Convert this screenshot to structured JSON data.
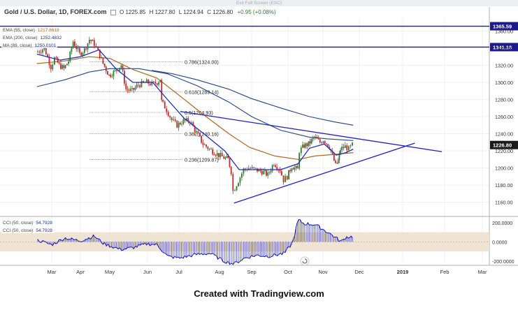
{
  "banner": {
    "text": "Exit Full Screen (ESC)"
  },
  "header": {
    "symbol": "Gold / U.S. Dollar, 1D, FOREX.com",
    "open": "O 1225.85",
    "high": "H 1227.80",
    "low": "L 1224.94",
    "close": "C 1226.80",
    "change": "+0.95 (+0.08%)"
  },
  "indicators": {
    "ema1": {
      "label": "EMA (55, close)",
      "value": "1217.8618"
    },
    "ema2": {
      "label": "EMA (200, close)",
      "value": "1252.4832"
    },
    "ma": {
      "label": "MA (89, close)",
      "value": "1250.0101"
    },
    "cci1": {
      "label": "CCI (50, close)",
      "value": "54.7928"
    },
    "cci2": {
      "label": "CCI (50, close)",
      "value": "54.7928"
    }
  },
  "footer": {
    "text": "Created with Tradingview.com"
  },
  "colors": {
    "price_up": "#2e7d32",
    "price_down": "#c62828",
    "ema_short": "#1a2fc4",
    "ema_mid": "#b5651d",
    "ema_long": "#22448e",
    "trendline": "#1f1fc8",
    "hline": "#1a1ab8",
    "cci": "#1414c8",
    "cci_band": "#efe4d3"
  },
  "chart_data": [
    {
      "type": "candlestick",
      "x_tick_labels": [
        "Mar",
        "Apr",
        "May",
        "Jun",
        "Jul",
        "Aug",
        "Sep",
        "Oct",
        "Nov",
        "Dec",
        "2019",
        "Feb",
        "Mar"
      ],
      "y_tick_labels": [
        "1160.00",
        "1180.00",
        "1200.00",
        "1220.00",
        "1240.00",
        "1260.00",
        "1280.00",
        "1300.00",
        "1320.00",
        "1340.00",
        "1360.00"
      ],
      "ylim": [
        1145,
        1375
      ],
      "last_price": 1226.8,
      "horizontal_levels": [
        {
          "value": 1365.59,
          "label": "1365.59"
        },
        {
          "value": 1341.18,
          "label": "1341.18"
        }
      ],
      "fibonacci_levels": [
        {
          "label": "0.786(1324.00)",
          "value": 1324.0
        },
        {
          "label": "0.618(1289.14)",
          "value": 1289.14
        },
        {
          "label": "0.5(1264.93)",
          "value": 1264.93
        },
        {
          "label": "0.382(1240.16)",
          "value": 1240.16
        },
        {
          "label": "0.236(1209.87)",
          "value": 1209.87
        }
      ],
      "close_path": [
        [
          "Feb 20",
          1335
        ],
        [
          "Feb 25",
          1340
        ],
        [
          "Mar 1",
          1318
        ],
        [
          "Mar 5",
          1328
        ],
        [
          "Mar 10",
          1320
        ],
        [
          "Mar 15",
          1316
        ],
        [
          "Mar 20",
          1325
        ],
        [
          "Mar 25",
          1348
        ],
        [
          "Apr 1",
          1333
        ],
        [
          "Apr 6",
          1338
        ],
        [
          "Apr 11",
          1350
        ],
        [
          "Apr 16",
          1345
        ],
        [
          "Apr 20",
          1336
        ],
        [
          "Apr 25",
          1322
        ],
        [
          "May 1",
          1308
        ],
        [
          "May 6",
          1313
        ],
        [
          "May 11",
          1320
        ],
        [
          "May 15",
          1292
        ],
        [
          "May 20",
          1290
        ],
        [
          "May 25",
          1297
        ],
        [
          "Jun 1",
          1300
        ],
        [
          "Jun 6",
          1298
        ],
        [
          "Jun 11",
          1300
        ],
        [
          "Jun 14",
          1304
        ],
        [
          "Jun 15",
          1278
        ],
        [
          "Jun 20",
          1268
        ],
        [
          "Jun 25",
          1256
        ],
        [
          "Jun 30",
          1250
        ],
        [
          "Jul 5",
          1255
        ],
        [
          "Jul 10",
          1255
        ],
        [
          "Jul 15",
          1241
        ],
        [
          "Jul 20",
          1228
        ],
        [
          "Jul 25",
          1222
        ],
        [
          "Aug 1",
          1215
        ],
        [
          "Aug 6",
          1212
        ],
        [
          "Aug 10",
          1210
        ],
        [
          "Aug 13",
          1196
        ],
        [
          "Aug 15",
          1173
        ],
        [
          "Aug 20",
          1185
        ],
        [
          "Aug 25",
          1198
        ],
        [
          "Aug 30",
          1200
        ],
        [
          "Sep 5",
          1198
        ],
        [
          "Sep 10",
          1196
        ],
        [
          "Sep 15",
          1192
        ],
        [
          "Sep 20",
          1206
        ],
        [
          "Sep 25",
          1198
        ],
        [
          "Sep 28",
          1186
        ],
        [
          "Oct 1",
          1190
        ],
        [
          "Oct 5",
          1202
        ],
        [
          "Oct 10",
          1198
        ],
        [
          "Oct 12",
          1220
        ],
        [
          "Oct 16",
          1226
        ],
        [
          "Oct 20",
          1228
        ],
        [
          "Oct 25",
          1236
        ],
        [
          "Oct 30",
          1230
        ],
        [
          "Nov 2",
          1233
        ],
        [
          "Nov 7",
          1225
        ],
        [
          "Nov 12",
          1203
        ],
        [
          "Nov 14",
          1208
        ],
        [
          "Nov 16",
          1222
        ],
        [
          "Nov 20",
          1225
        ],
        [
          "Nov 23",
          1222
        ],
        [
          "Nov 26",
          1226.8
        ]
      ],
      "ema_short_path": [
        [
          "Feb 20",
          1333
        ],
        [
          "Mar 10",
          1326
        ],
        [
          "Apr 1",
          1330
        ],
        [
          "Apr 20",
          1338
        ],
        [
          "May 6",
          1316
        ],
        [
          "May 20",
          1300
        ],
        [
          "Jun 6",
          1300
        ],
        [
          "Jun 20",
          1280
        ],
        [
          "Jul 5",
          1258
        ],
        [
          "Jul 20",
          1240
        ],
        [
          "Aug 6",
          1220
        ],
        [
          "Aug 20",
          1198
        ],
        [
          "Sep 10",
          1198
        ],
        [
          "Sep 25",
          1198
        ],
        [
          "Oct 10",
          1205
        ],
        [
          "Oct 20",
          1223
        ],
        [
          "Nov 2",
          1228
        ],
        [
          "Nov 12",
          1215
        ],
        [
          "Nov 20",
          1218
        ],
        [
          "Nov 26",
          1222
        ]
      ],
      "ema_mid_path": [
        [
          "Feb 20",
          1322
        ],
        [
          "Mar 15",
          1325
        ],
        [
          "Apr 10",
          1330
        ],
        [
          "May 1",
          1328
        ],
        [
          "May 20",
          1315
        ],
        [
          "Jun 10",
          1305
        ],
        [
          "Jul 1",
          1285
        ],
        [
          "Jul 20",
          1262
        ],
        [
          "Aug 10",
          1240
        ],
        [
          "Aug 30",
          1224
        ],
        [
          "Sep 20",
          1214
        ],
        [
          "Oct 10",
          1210
        ],
        [
          "Oct 25",
          1214
        ],
        [
          "Nov 12",
          1216
        ],
        [
          "Nov 26",
          1217.9
        ]
      ],
      "ema_long_path": [
        [
          "Feb 20",
          1295
        ],
        [
          "Mar 15",
          1303
        ],
        [
          "Apr 10",
          1312
        ],
        [
          "May 1",
          1316
        ],
        [
          "May 25",
          1316
        ],
        [
          "Jun 20",
          1310
        ],
        [
          "Jul 15",
          1296
        ],
        [
          "Aug 10",
          1277
        ],
        [
          "Sep 1",
          1260
        ],
        [
          "Sep 25",
          1244
        ],
        [
          "Oct 20",
          1236
        ],
        [
          "Nov 5",
          1234
        ],
        [
          "Nov 26",
          1232
        ]
      ],
      "ma_long_path": [
        [
          "Jun 5",
          1314
        ],
        [
          "Jun 25",
          1310
        ],
        [
          "Jul 15",
          1303
        ],
        [
          "Aug 10",
          1292
        ],
        [
          "Sep 1",
          1281
        ],
        [
          "Sep 25",
          1270
        ],
        [
          "Oct 20",
          1260
        ],
        [
          "Nov 10",
          1254
        ],
        [
          "Nov 26",
          1250
        ]
      ],
      "trendlines": [
        {
          "from": [
            "Jul 2",
            1266
          ],
          "to": [
            "Jan 30",
            1219
          ]
        },
        {
          "from": [
            "Aug 15",
            1159
          ],
          "to": [
            "Jan 10",
            1229
          ]
        }
      ]
    },
    {
      "type": "line",
      "name": "CCI",
      "y_tick_labels": [
        "200.0000",
        "0.0000",
        "-200.0000"
      ],
      "ylim": [
        -230,
        250
      ],
      "band": [
        -100,
        100
      ],
      "last_value": 54.7928,
      "path": [
        [
          "Feb 20",
          20
        ],
        [
          "Mar 1",
          -30
        ],
        [
          "Mar 15",
          40
        ],
        [
          "Apr 1",
          10
        ],
        [
          "Apr 15",
          60
        ],
        [
          "Apr 25",
          -20
        ],
        [
          "May 10",
          -80
        ],
        [
          "May 20",
          -60
        ],
        [
          "Jun 1",
          -20
        ],
        [
          "Jun 10",
          -30
        ],
        [
          "Jun 20",
          -150
        ],
        [
          "Jul 1",
          -170
        ],
        [
          "Jul 15",
          -130
        ],
        [
          "Jul 25",
          -120
        ],
        [
          "Aug 5",
          -200
        ],
        [
          "Aug 15",
          -230
        ],
        [
          "Aug 25",
          -170
        ],
        [
          "Sep 5",
          -140
        ],
        [
          "Sep 15",
          -150
        ],
        [
          "Sep 28",
          -120
        ],
        [
          "Oct 5",
          -10
        ],
        [
          "Oct 10",
          230
        ],
        [
          "Oct 15",
          190
        ],
        [
          "Oct 25",
          180
        ],
        [
          "Nov 5",
          100
        ],
        [
          "Nov 12",
          40
        ],
        [
          "Nov 16",
          0
        ],
        [
          "Nov 20",
          50
        ],
        [
          "Nov 26",
          54.79
        ]
      ]
    }
  ]
}
